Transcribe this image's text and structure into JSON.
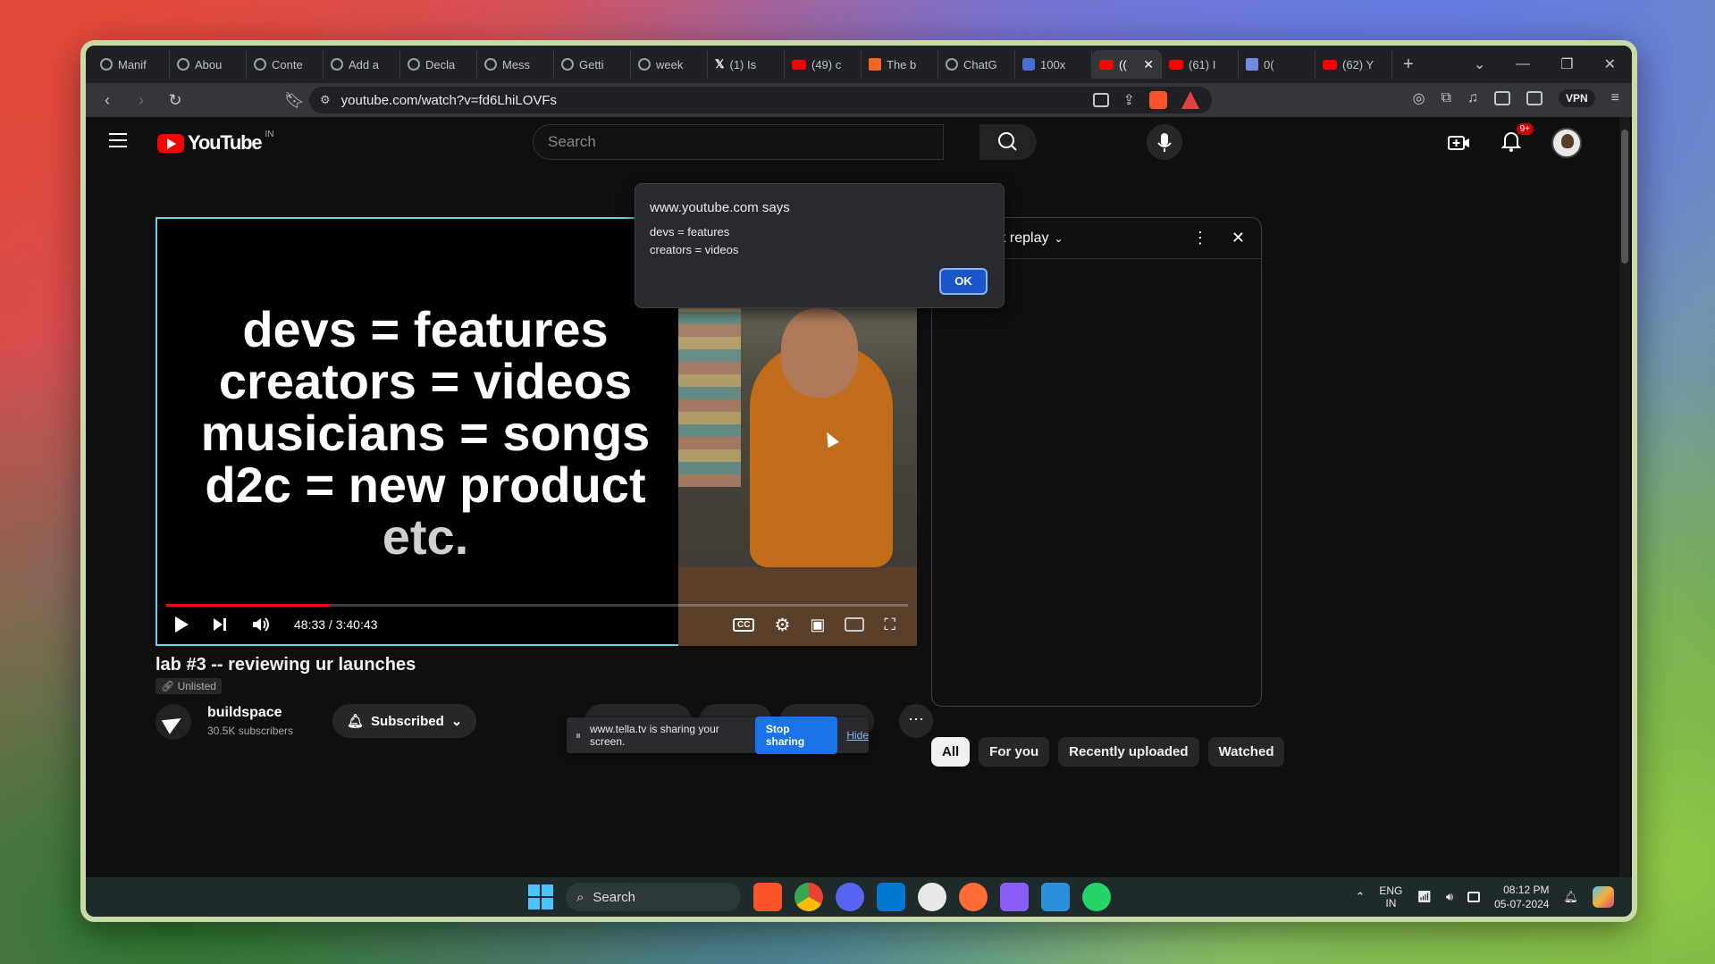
{
  "browser": {
    "tabs": [
      {
        "label": "Manif",
        "icon": "chatgpt-icon"
      },
      {
        "label": "Abou",
        "icon": "chatgpt-icon"
      },
      {
        "label": "Conte",
        "icon": "chatgpt-icon"
      },
      {
        "label": "Add a",
        "icon": "chatgpt-icon"
      },
      {
        "label": "Decla",
        "icon": "chatgpt-icon"
      },
      {
        "label": "Mess",
        "icon": "chatgpt-icon"
      },
      {
        "label": "Getti",
        "icon": "chatgpt-icon"
      },
      {
        "label": "week",
        "icon": "chatgpt-icon"
      },
      {
        "label": "(1) Is",
        "icon": "x-icon"
      },
      {
        "label": "(49) c",
        "icon": "youtube-icon"
      },
      {
        "label": "The b",
        "icon": "orange-square-icon"
      },
      {
        "label": "ChatG",
        "icon": "chatgpt-icon"
      },
      {
        "label": "100x",
        "icon": "blue-app-icon"
      },
      {
        "label": "((",
        "icon": "youtube-icon",
        "active": true
      },
      {
        "label": "(61) I",
        "icon": "youtube-icon"
      },
      {
        "label": "0(",
        "icon": "grid-app-icon"
      },
      {
        "label": "(62) Y",
        "icon": "youtube-icon"
      }
    ],
    "url": "youtube.com/watch?v=fd6LhiLOVFs",
    "vpn_label": "VPN"
  },
  "youtube": {
    "logo_text": "YouTube",
    "region": "IN",
    "search_placeholder": "Search",
    "notifications_badge": "9+"
  },
  "alert": {
    "title": "www.youtube.com says",
    "line1": "devs = features",
    "line2": "creators = videos",
    "ok_label": "OK"
  },
  "player": {
    "slide_lines": [
      "devs = features",
      "creators = videos",
      "musicians = songs",
      "d2c = new product",
      "etc."
    ],
    "time": "48:33 / 3:40:43",
    "progress_fraction": 0.22,
    "cc_label": "CC"
  },
  "video": {
    "title": "lab #3 -- reviewing ur launches",
    "visibility": "Unlisted",
    "channel_name": "buildspace",
    "subscribers": "30.5K subscribers",
    "subscribe_label": "Subscribed"
  },
  "share_banner": {
    "text": "www.tella.tv is sharing your screen.",
    "stop_label": "Stop sharing",
    "hide_label": "Hide"
  },
  "chat": {
    "title": "Top chat replay"
  },
  "chips": [
    "All",
    "For you",
    "Recently uploaded",
    "Watched"
  ],
  "taskbar": {
    "search_label": "Search",
    "lang_line1": "ENG",
    "lang_line2": "IN",
    "time": "08:12 PM",
    "date": "05-07-2024"
  },
  "colors": {
    "accent_red": "#ff0000",
    "player_border": "#6ad3e6",
    "dialog_button": "#1a55c9",
    "stop_sharing": "#1a73e8"
  }
}
